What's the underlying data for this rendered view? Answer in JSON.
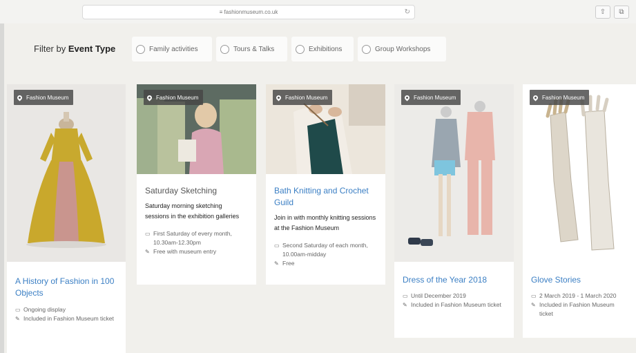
{
  "browser": {
    "url": "≡ fashionmuseum.co.uk",
    "reload_glyph": "↻",
    "share_glyph": "⇧",
    "tabs_glyph": "⧉"
  },
  "filter": {
    "label_prefix": "Filter by",
    "label_strong": "Event Type",
    "options": [
      {
        "label": "Family activities"
      },
      {
        "label": "Tours & Talks"
      },
      {
        "label": "Exhibitions"
      },
      {
        "label": "Group Workshops"
      }
    ]
  },
  "cards": [
    {
      "badge": "Fashion Museum",
      "title": "A History of Fashion in 100 Objects",
      "description": "",
      "date_icon": "calendar-icon",
      "date": "Ongoing display",
      "price_icon": "tag-icon",
      "price": "Included in Fashion Museum ticket"
    },
    {
      "badge": "Fashion Museum",
      "title": "Saturday Sketching",
      "description": "Saturday morning sketching sessions in the exhibition galleries",
      "date_icon": "calendar-icon",
      "date": "First Saturday of every month, 10.30am-12.30pm",
      "price_icon": "tag-icon",
      "price": "Free with museum entry"
    },
    {
      "badge": "Fashion Museum",
      "title": "Bath Knitting and Crochet Guild",
      "description": "Join in with monthly knitting sessions at the Fashion Museum",
      "date_icon": "calendar-icon",
      "date": "Second Saturday of each month, 10.00am-midday",
      "price_icon": "tag-icon",
      "price": "Free"
    },
    {
      "badge": "Fashion Museum",
      "title": "Dress of the Year 2018",
      "description": "",
      "date_icon": "calendar-icon",
      "date": "Until December 2019",
      "price_icon": "tag-icon",
      "price": "Included in Fashion Museum ticket"
    },
    {
      "badge": "Fashion Museum",
      "title": "Glove Stories",
      "description": "",
      "date_icon": "calendar-icon",
      "date": "2 March 2019 - 1 March 2020",
      "price_icon": "tag-icon",
      "price": "Included in Fashion Museum ticket"
    }
  ],
  "colors": {
    "link": "#3b7fc4",
    "background": "#f1f0ec",
    "badge": "#464646"
  }
}
